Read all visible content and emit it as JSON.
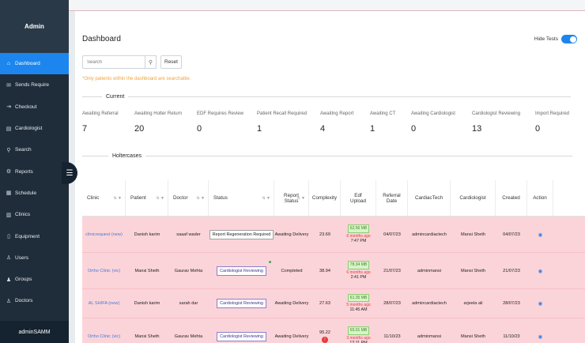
{
  "sidebar": {
    "title": "Admin",
    "items": [
      {
        "label": "Dashboard",
        "icon": "home-icon",
        "glyph": "⌂",
        "active": true
      },
      {
        "label": "Sends Require",
        "icon": "mail-icon",
        "glyph": "✉",
        "active": false
      },
      {
        "label": "Checkout",
        "icon": "logout-icon",
        "glyph": "⇥",
        "active": false
      },
      {
        "label": "Cardiologist",
        "icon": "list-icon",
        "glyph": "▤",
        "active": false
      },
      {
        "label": "Search",
        "icon": "search-icon",
        "glyph": "⚲",
        "active": false
      },
      {
        "label": "Reports",
        "icon": "gear-icon",
        "glyph": "⚙",
        "active": false
      },
      {
        "label": "Schedule",
        "icon": "calendar-icon",
        "glyph": "▦",
        "active": false
      },
      {
        "label": "Clinics",
        "icon": "building-icon",
        "glyph": "▥",
        "active": false
      },
      {
        "label": "Equipment",
        "icon": "device-icon",
        "glyph": "▯",
        "active": false
      },
      {
        "label": "Users",
        "icon": "user-icon",
        "glyph": "♙",
        "active": false
      },
      {
        "label": "Groups",
        "icon": "group-icon",
        "glyph": "♟",
        "active": false
      },
      {
        "label": "Doctors",
        "icon": "doctor-icon",
        "glyph": "♙",
        "active": false
      }
    ],
    "user": "adminSAMM",
    "toggle_glyph": "☰"
  },
  "header": {
    "title": "Dashboard",
    "hide_tests_label": "Hide Tests"
  },
  "search": {
    "placeholder": "Search",
    "search_glyph": "⚲",
    "reset_label": "Reset",
    "note": "*Only patients within the dashboard are searchable."
  },
  "current": {
    "title": "Current",
    "stats": [
      {
        "label": "Awaiting Referral",
        "value": "7"
      },
      {
        "label": "Awaiting Holter Return",
        "value": "20"
      },
      {
        "label": "EDF Requires Review",
        "value": "0"
      },
      {
        "label": "Patient Recall Required",
        "value": "1"
      },
      {
        "label": "Awaiting Report",
        "value": "4"
      },
      {
        "label": "Awaiting CT",
        "value": "1"
      },
      {
        "label": "Awaiting Cardiologist",
        "value": "0"
      },
      {
        "label": "Cardiologist Reviewing",
        "value": "13"
      },
      {
        "label": "Import Required",
        "value": "0"
      }
    ]
  },
  "holtercases": {
    "title": "Holtercases",
    "columns": [
      "Clinic",
      "Patient",
      "Doctor",
      "Status",
      "Report Status",
      "Complexity",
      "Edf Upload",
      "Referral Date",
      "CardiacTech",
      "Cardiologist",
      "Created",
      "Action"
    ],
    "filter_glyph": "⇅ ▼",
    "eye_glyph": "◉",
    "rows": [
      {
        "clinic": "clinicrequest (new)",
        "patient": "Danish karim",
        "doctor": "saaaf wader",
        "status": "Report Regeneration Required",
        "status_style": "plain",
        "report_status": "Awaiting Delivery",
        "complexity": "23.69",
        "flag": "",
        "edf_size": "62.56 MB",
        "edf_ago": "6 months ago",
        "edf_time": "7:47 PM",
        "referral_date": "04/07/23",
        "cardiactech": "admincardiactech",
        "cardiologist": "Mansi Sheth",
        "created": "04/07/23"
      },
      {
        "clinic": "Ortho Clinic (vic)",
        "patient": "Mansi Sheth",
        "doctor": "Gaurav Mehta",
        "status": "Cardiologist Reviewing",
        "status_style": "purple",
        "report_status": "Completed",
        "complexity": "38.94",
        "flag": "",
        "edf_size": "78.34 MB",
        "edf_ago": "6 months ago",
        "edf_time": "2:41 PM",
        "referral_date": "21/07/23",
        "cardiactech": "adminmansi",
        "cardiologist": "Mansi Sheth",
        "created": "21/07/23"
      },
      {
        "clinic": "AL SHIFA (new)",
        "patient": "Danish karim",
        "doctor": "sarah dar",
        "status": "Cardiologist Reviewing",
        "status_style": "purple",
        "report_status": "Awaiting Delivery",
        "complexity": "27.63",
        "flag": "",
        "edf_size": "61.35 MB",
        "edf_ago": "5 months ago",
        "edf_time": "11:45 AM",
        "referral_date": "28/07/23",
        "cardiactech": "admincardiactech",
        "cardiologist": "arjeela ali",
        "created": "28/07/23"
      },
      {
        "clinic": "Ortho Clinic (vic)",
        "patient": "Mansi Sheth",
        "doctor": "Gaurav Mehta",
        "status": "Cardiologist Reviewing",
        "status_style": "purple",
        "report_status": "Awaiting Delivery",
        "complexity": "95.22",
        "flag": "!",
        "edf_size": "65.01 MB",
        "edf_ago": "3 months ago",
        "edf_time": "12:11 PM",
        "referral_date": "11/10/23",
        "cardiactech": "adminmansi",
        "cardiologist": "Mansi Sheth",
        "created": "11/10/23"
      }
    ]
  },
  "colors": {
    "accent": "#1c86ee",
    "row_bg": "#fbd4d9",
    "sidebar": "#1f2d3a",
    "warning": "#f0a33c"
  }
}
